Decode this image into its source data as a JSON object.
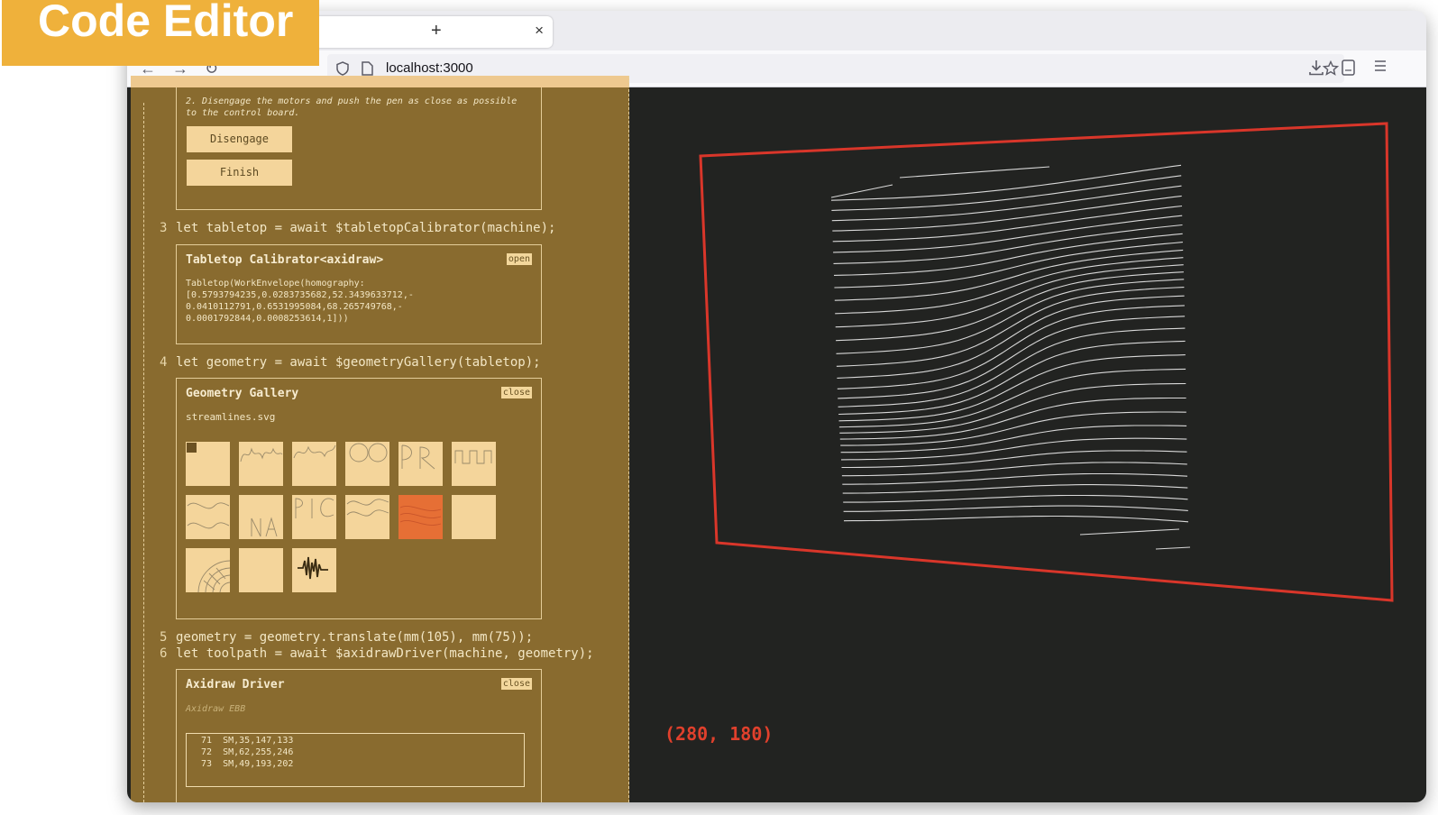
{
  "banner": {
    "label": "Code Editor"
  },
  "browser": {
    "tab_close": "×",
    "new_tab": "+",
    "url": "localhost:3000"
  },
  "editor": {
    "step2": {
      "instruction": "2. Disengage the motors and push the pen as close as possible\nto the control board.",
      "disengage_label": "Disengage",
      "finish_label": "Finish"
    },
    "line3": {
      "num": "3",
      "code": "let tabletop = await $tabletopCalibrator(machine);"
    },
    "tabletop_cell": {
      "title": "Tabletop Calibrator<axidraw>",
      "toggle": "open",
      "output": "Tabletop(WorkEnvelope(homography:\n[0.5793794235,0.0283735682,52.3439633712,-\n0.0410112791,0.6531995084,68.265749768,-\n0.0001792844,0.0008253614,1]))"
    },
    "line4": {
      "num": "4",
      "code": "let geometry = await $geometryGallery(tabletop);"
    },
    "gallery_cell": {
      "title": "Geometry Gallery",
      "toggle": "close",
      "filename": "streamlines.svg"
    },
    "line5": {
      "num": "5",
      "code": "geometry = geometry.translate(mm(105), mm(75));"
    },
    "line6": {
      "num": "6",
      "code": "let toolpath = await $axidrawDriver(machine, geometry);"
    },
    "driver_cell": {
      "title": "Axidraw Driver",
      "toggle": "close",
      "subtitle": "Axidraw EBB",
      "commands": [
        {
          "num": "71",
          "cmd": "SM,35,147,133"
        },
        {
          "num": "72",
          "cmd": "SM,62,255,246"
        },
        {
          "num": "73",
          "cmd": "SM,49,193,202"
        }
      ]
    }
  },
  "preview": {
    "coordinates": "(280, 180)",
    "colors": {
      "envelope": "#d9362a",
      "strokes": "#d8d8d8"
    }
  }
}
